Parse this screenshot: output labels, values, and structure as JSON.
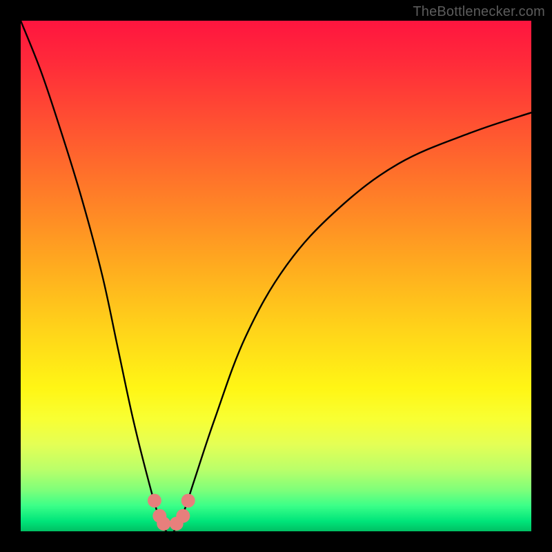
{
  "watermark": {
    "text": "TheBottlenecker.com"
  },
  "chart_data": {
    "type": "line",
    "title": "",
    "xlabel": "",
    "ylabel": "",
    "xlim": [
      0,
      100
    ],
    "ylim": [
      0,
      100
    ],
    "series": [
      {
        "name": "bottleneck-curve",
        "x": [
          0,
          4,
          8,
          12,
          16,
          19,
          22,
          25,
          27,
          28.5,
          30,
          32,
          34,
          38,
          44,
          52,
          62,
          74,
          88,
          100
        ],
        "y": [
          100,
          90,
          78,
          65,
          50,
          36,
          22,
          10,
          3,
          0,
          0,
          4,
          10,
          22,
          38,
          52,
          63,
          72,
          78,
          82
        ]
      }
    ],
    "markers": {
      "name": "highlight-dots",
      "color": "#e77f7c",
      "radius_px": 10,
      "points_xy": [
        [
          26.2,
          6.0
        ],
        [
          27.2,
          3.0
        ],
        [
          28.0,
          1.5
        ],
        [
          30.5,
          1.5
        ],
        [
          31.8,
          3.0
        ],
        [
          32.8,
          6.0
        ]
      ]
    },
    "gradient_stops": [
      {
        "pos": 0,
        "color": "#ff153f"
      },
      {
        "pos": 50,
        "color": "#ffb81f"
      },
      {
        "pos": 78,
        "color": "#f8ff33"
      },
      {
        "pos": 100,
        "color": "#00bf63"
      }
    ]
  }
}
